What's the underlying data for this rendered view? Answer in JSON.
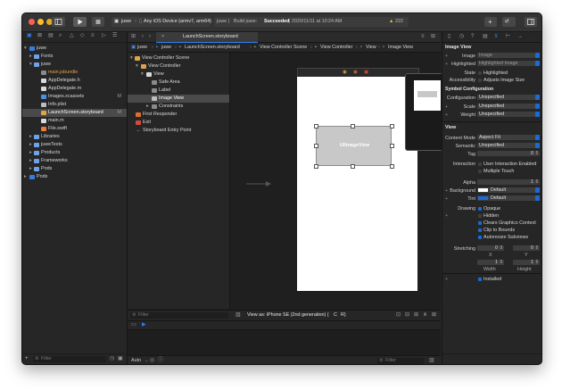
{
  "toolbar": {
    "scheme": "juwe",
    "destination": "Any iOS Device (armv7, arm64)",
    "status_project": "juwe |",
    "status_build": "Build juwe:",
    "status_result": "Succeeded",
    "status_time": "| 2020/11/11 at 10:24 AM",
    "warning_count": "222"
  },
  "navigator": {
    "items": [
      {
        "label": "juwe",
        "badge": ""
      },
      {
        "label": "Fonts",
        "badge": ""
      },
      {
        "label": "juwe",
        "badge": ""
      },
      {
        "label": "main.jsbundle",
        "badge": ""
      },
      {
        "label": "AppDelegate.h",
        "badge": ""
      },
      {
        "label": "AppDelegate.m",
        "badge": ""
      },
      {
        "label": "Images.xcassets",
        "badge": "M"
      },
      {
        "label": "Info.plist",
        "badge": ""
      },
      {
        "label": "LaunchScreen.storyboard",
        "badge": "M"
      },
      {
        "label": "main.m",
        "badge": ""
      },
      {
        "label": "File.swift",
        "badge": ""
      },
      {
        "label": "Libraries",
        "badge": ""
      },
      {
        "label": "juweTests",
        "badge": ""
      },
      {
        "label": "Products",
        "badge": ""
      },
      {
        "label": "Frameworks",
        "badge": ""
      },
      {
        "label": "Pods",
        "badge": ""
      },
      {
        "label": "Pods",
        "badge": ""
      }
    ],
    "filter_placeholder": "Filter"
  },
  "editor": {
    "tab": "LaunchScreen.storyboard",
    "jump_bar": [
      "juwe",
      "juwe",
      "LaunchScreen.storyboard",
      "View Controller Scene",
      "View Controller",
      "View",
      "Image View"
    ],
    "outline": [
      "View Controller Scene",
      "View Controller",
      "View",
      "Safe Area",
      "Label",
      "Image View",
      "Constraints",
      "First Responder",
      "Exit",
      "Storyboard Entry Point"
    ],
    "image_view_label": "UIImageView",
    "outline_filter_placeholder": "Filter",
    "view_as": "View as: iPhone SE (2nd generation) (",
    "view_as_size": "C",
    "view_as_end": "R)",
    "debug_auto": "Auto",
    "debug_filter_placeholder": "Filter"
  },
  "inspector": {
    "image_view_title": "Image View",
    "image_label": "Image",
    "image_value": "Image",
    "highlighted_label": "Highlighted",
    "highlighted_value": "Highlighted Image",
    "state_label": "State",
    "state_option": "Highlighted",
    "accessibility_label": "Accessibility",
    "accessibility_option": "Adjusts Image Size",
    "symbol_title": "Symbol Configuration",
    "configuration_label": "Configuration",
    "configuration_value": "Unspecified",
    "scale_label": "Scale",
    "scale_value": "Unspecified",
    "weight_label": "Weight",
    "weight_value": "Unspecified",
    "view_title": "View",
    "content_mode_label": "Content Mode",
    "content_mode_value": "Aspect Fit",
    "semantic_label": "Semantic",
    "semantic_value": "Unspecified",
    "tag_label": "Tag",
    "tag_value": "0",
    "interaction_label": "Interaction",
    "interaction_opt1": "User Interaction Enabled",
    "interaction_opt2": "Multiple Touch",
    "alpha_label": "Alpha",
    "alpha_value": "1",
    "background_label": "Background",
    "background_value": "Default",
    "tint_label": "Tint",
    "tint_value": "Default",
    "drawing_label": "Drawing",
    "drawing_opts": [
      "Opaque",
      "Hidden",
      "Clears Graphics Context",
      "Clip to Bounds",
      "Autoresize Subviews"
    ],
    "stretching_label": "Stretching",
    "stretch_x": "0",
    "stretch_y": "0",
    "stretch_w": "1",
    "stretch_h": "1",
    "x_label": "X",
    "y_label": "Y",
    "width_label": "Width",
    "height_label": "Height",
    "installed_label": "Installed"
  }
}
